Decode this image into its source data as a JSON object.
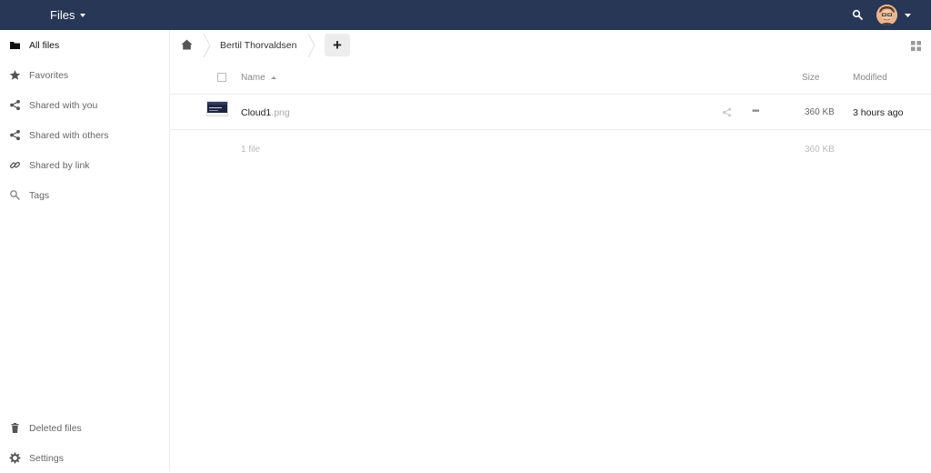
{
  "header": {
    "app_title": "Files",
    "icons": {
      "search": "search-icon",
      "avatar": "user-avatar",
      "menu_caret": "chevron-down-icon"
    },
    "colors": {
      "bar": "#283755",
      "text": "#ffffff"
    }
  },
  "sidebar": {
    "items": [
      {
        "label": "All files",
        "icon": "folder-icon",
        "active": true
      },
      {
        "label": "Favorites",
        "icon": "star-icon"
      },
      {
        "label": "Shared with you",
        "icon": "share-icon"
      },
      {
        "label": "Shared with others",
        "icon": "share-icon"
      },
      {
        "label": "Shared by link",
        "icon": "link-icon"
      },
      {
        "label": "Tags",
        "icon": "tag-search-icon"
      }
    ],
    "bottom_items": [
      {
        "label": "Deleted files",
        "icon": "trash-icon"
      },
      {
        "label": "Settings",
        "icon": "gear-icon"
      }
    ]
  },
  "breadcrumb": {
    "home_icon": "home-icon",
    "current": "Bertil Thorvaldsen",
    "add_label": "+"
  },
  "file_list": {
    "columns": {
      "name": "Name",
      "size": "Size",
      "modified": "Modified"
    },
    "sort": {
      "column": "name",
      "direction": "ascending"
    },
    "rows": [
      {
        "basename": "Cloud1",
        "extension": ".png",
        "size": "360 KB",
        "modified": "3 hours ago"
      }
    ],
    "summary": {
      "count": "1 file",
      "size": "360 KB"
    }
  }
}
